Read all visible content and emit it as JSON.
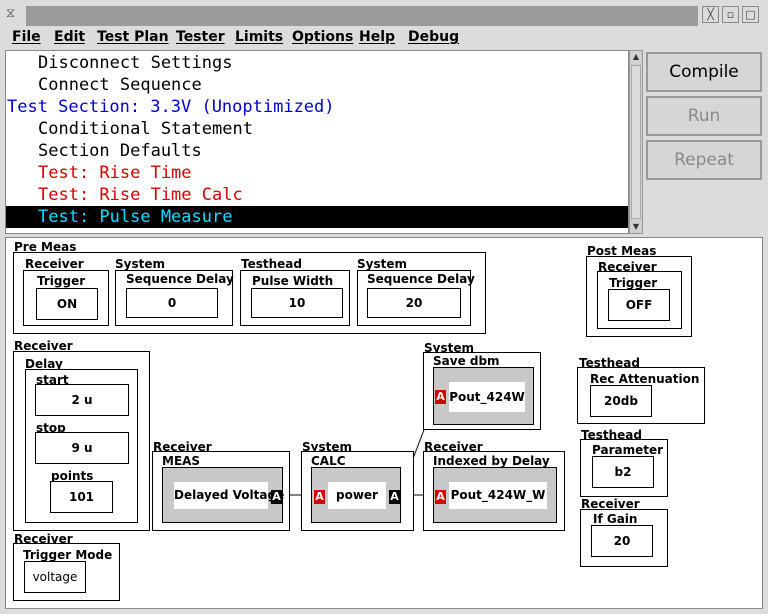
{
  "menubar": [
    "File",
    "Edit",
    "Test Plan",
    "Tester",
    "Limits",
    "Options",
    "Help",
    "Debug"
  ],
  "testlist": [
    {
      "text": "Disconnect Settings",
      "color": "#000000"
    },
    {
      "text": "Connect Sequence",
      "color": "#000000"
    },
    {
      "text": "Test Section: 3.3V (Unoptimized)",
      "color": "#0000cc"
    },
    {
      "text": "Conditional Statement",
      "color": "#000000"
    },
    {
      "text": "Section Defaults",
      "color": "#000000"
    },
    {
      "text": "Test: Rise Time",
      "color": "#d40000"
    },
    {
      "text": "Test: Rise Time Calc",
      "color": "#d40000"
    },
    {
      "text": "Test: Pulse Measure",
      "color": "#00e0ff",
      "selected": true
    }
  ],
  "buttons": {
    "compile": "Compile",
    "run": "Run",
    "repeat": "Repeat"
  },
  "premeas": {
    "title": "Pre Meas",
    "receiver": {
      "label": "Receiver",
      "param": "Trigger",
      "value": "ON"
    },
    "system1": {
      "label": "System",
      "param": "Sequence Delay",
      "value": "0"
    },
    "testhead": {
      "label": "Testhead",
      "param": "Pulse Width",
      "value": "10"
    },
    "system2": {
      "label": "System",
      "param": "Sequence Delay",
      "value": "20"
    }
  },
  "postmeas": {
    "title": "Post Meas",
    "receiver": {
      "label": "Receiver",
      "param": "Trigger",
      "value": "OFF"
    }
  },
  "delay": {
    "group": "Receiver",
    "title": "Delay",
    "start_label": "start",
    "start": "2 u",
    "stop_label": "stop",
    "stop": "9 u",
    "points_label": "points",
    "points": "101"
  },
  "trigmode": {
    "group": "Receiver",
    "param": "Trigger Mode",
    "value": "voltage"
  },
  "meas": {
    "group": "Receiver",
    "title": "MEAS",
    "value": "Delayed Voltage",
    "port": "A"
  },
  "calc": {
    "group": "System",
    "title": "CALC",
    "value": "power",
    "in_port": "A",
    "out_port": "A"
  },
  "savedbm": {
    "group": "System",
    "title": "Save dbm",
    "value": "Pout_424W",
    "port": "A"
  },
  "indexed": {
    "group": "Receiver",
    "title": "Indexed by Delay",
    "value": "Pout_424W_W",
    "port": "A"
  },
  "recatten": {
    "group": "Testhead",
    "param": "Rec Attenuation",
    "value": "20db"
  },
  "parameter": {
    "group": "Testhead",
    "param": "Parameter",
    "value": "b2"
  },
  "ifgain": {
    "group": "Receiver",
    "param": "If Gain",
    "value": "20"
  }
}
